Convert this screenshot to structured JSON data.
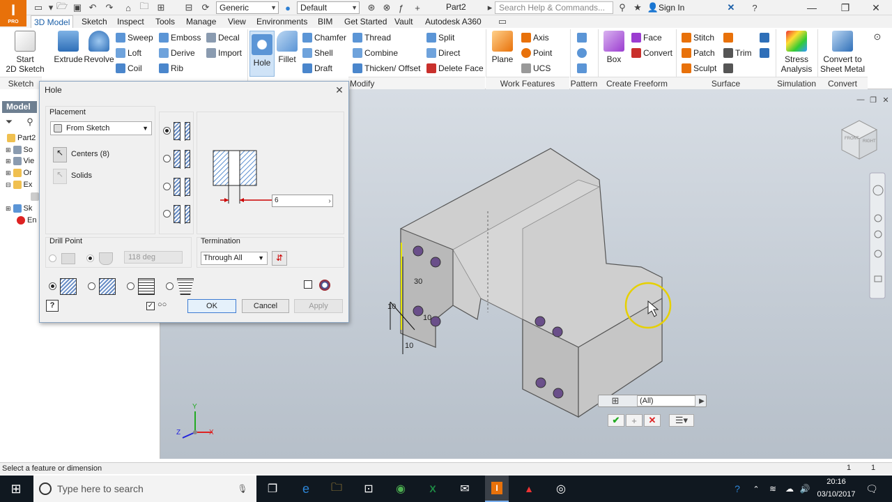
{
  "app": {
    "logo": "I",
    "logo_sub": "PRO",
    "doc_title": "Part2",
    "search_placeholder": "Search Help & Commands...",
    "signin": "Sign In",
    "material": "Generic",
    "appearance": "Default"
  },
  "tabs": [
    "3D Model",
    "Sketch",
    "Inspect",
    "Tools",
    "Manage",
    "View",
    "Environments",
    "BIM",
    "Get Started",
    "Vault",
    "Autodesk A360"
  ],
  "ribbon": {
    "start_sketch": "Start",
    "start_sketch2": "2D Sketch",
    "extrude": "Extrude",
    "revolve": "Revolve",
    "sweep": "Sweep",
    "loft": "Loft",
    "coil": "Coil",
    "emboss": "Emboss",
    "derive": "Derive",
    "rib": "Rib",
    "decal": "Decal",
    "import": "Import",
    "hole": "Hole",
    "fillet": "Fillet",
    "chamfer": "Chamfer",
    "shell": "Shell",
    "draft": "Draft",
    "thread": "Thread",
    "combine": "Combine",
    "thicken": "Thicken/ Offset",
    "split": "Split",
    "direct": "Direct",
    "delete_face": "Delete Face",
    "plane": "Plane",
    "axis": "Axis",
    "point": "Point",
    "ucs": "UCS",
    "box": "Box",
    "face": "Face",
    "convert": "Convert",
    "stitch": "Stitch",
    "patch": "Patch",
    "trim": "Trim",
    "sculpt": "Sculpt",
    "stress1": "Stress",
    "stress2": "Analysis",
    "convert_sm1": "Convert to",
    "convert_sm2": "Sheet Metal",
    "groups": {
      "sketch": "Sketch",
      "modify": "Modify",
      "work_features": "Work Features",
      "pattern": "Pattern",
      "create_freeform": "Create Freeform",
      "surface": "Surface",
      "simulation": "Simulation",
      "convert": "Convert"
    }
  },
  "browser": {
    "header": "Model",
    "items": [
      "Part2",
      "So",
      "Vie",
      "Or",
      "Ex",
      "Sk",
      "En"
    ]
  },
  "dialog": {
    "title": "Hole",
    "placement_label": "Placement",
    "placement_value": "From Sketch",
    "centers": "Centers (8)",
    "solids": "Solids",
    "distance_value": "6",
    "drill_point_label": "Drill Point",
    "drill_angle": "118 deg",
    "termination_label": "Termination",
    "termination_value": "Through All",
    "ok": "OK",
    "cancel": "Cancel",
    "apply": "Apply"
  },
  "viewport": {
    "dim_30": "30",
    "dim_10a": "10",
    "dim_10b": "10",
    "dim_10c": "10",
    "filter_value": "(All)",
    "axis_x": "X",
    "axis_y": "Y",
    "axis_z": "Z",
    "viewcube_front": "FRONT",
    "viewcube_right": "RIGHT"
  },
  "status": {
    "message": "Select a feature or dimension",
    "count1": "1",
    "count2": "1"
  },
  "taskbar": {
    "search_placeholder": "Type here to search",
    "time": "20:16",
    "date": "03/10/2017"
  }
}
